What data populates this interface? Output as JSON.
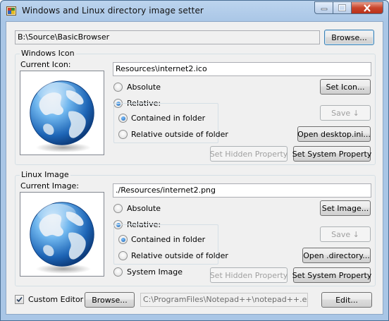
{
  "window": {
    "title": "Windows and Linux directory image setter"
  },
  "path": {
    "value": "B:\\Source\\BasicBrowser",
    "browse_label": "Browse..."
  },
  "windows_icon": {
    "group_label": "Windows Icon",
    "current_label": "Current Icon:",
    "path_value": "Resources\\internet2.ico",
    "absolute_label": "Absolute",
    "relative_label": "Relative:",
    "contained_label": "Contained in folder",
    "outside_label": "Relative outside of folder",
    "set_button": "Set Icon...",
    "save_button": "Save ↓",
    "open_button": "Open desktop.ini...",
    "hidden_button": "Set Hidden Property",
    "system_button": "Set System Property"
  },
  "linux_image": {
    "group_label": "Linux Image",
    "current_label": "Current Image:",
    "path_value": "./Resources/internet2.png",
    "absolute_label": "Absolute",
    "relative_label": "Relative:",
    "contained_label": "Contained in folder",
    "outside_label": "Relative outside of folder",
    "system_image_label": "System Image",
    "set_button": "Set Image...",
    "save_button": "Save ↓",
    "open_button": "Open .directory...",
    "hidden_button": "Set Hidden Property",
    "system_button": "Set System Property"
  },
  "editor": {
    "custom_label": "Custom Editor",
    "custom_checked": true,
    "browse_label": "Browse...",
    "path_value": "C:\\ProgramFiles\\Notepad++\\notepad++.exe",
    "edit_label": "Edit..."
  }
}
